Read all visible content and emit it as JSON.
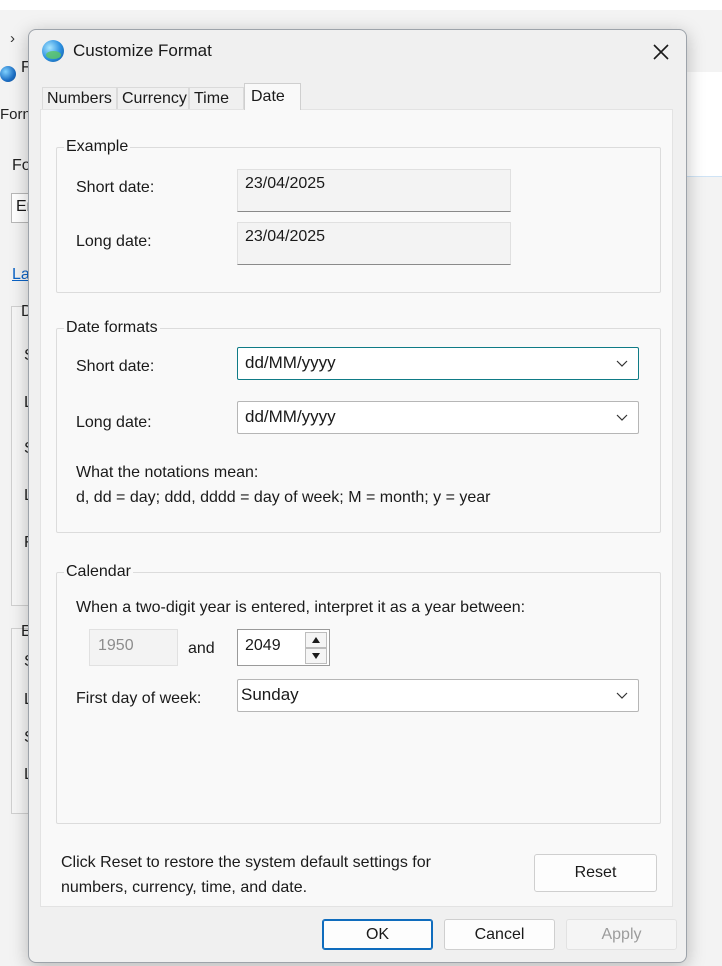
{
  "background": {
    "nav_glyph": "›",
    "labels": [
      "F",
      "Forn",
      "Fo",
      "Er",
      "La",
      "D",
      "S",
      "L",
      "S",
      "L",
      "F",
      "E",
      "S",
      "L",
      "S",
      "L"
    ]
  },
  "dialog": {
    "title": "Customize Format",
    "close_glyph": "✕",
    "tabs": [
      "Numbers",
      "Currency",
      "Time",
      "Date"
    ],
    "active_tab": "Date"
  },
  "example": {
    "legend": "Example",
    "short_label": "Short date:",
    "short_value": "23/04/2025",
    "long_label": "Long date:",
    "long_value": "23/04/2025"
  },
  "date_formats": {
    "legend": "Date formats",
    "short_label": "Short date:",
    "short_value": "dd/MM/yyyy",
    "long_label": "Long date:",
    "long_value": "dd/MM/yyyy",
    "notation_title": "What the notations mean:",
    "notation_text": "d, dd = day;  ddd, dddd = day of week;  M = month;  y = year"
  },
  "calendar": {
    "legend": "Calendar",
    "two_digit_text": "When a two-digit year is entered, interpret it as a year between:",
    "year_from": "1950",
    "and_label": "and",
    "year_to": "2049",
    "first_day_label": "First day of week:",
    "first_day_value": "Sunday"
  },
  "reset": {
    "text_line1": "Click Reset to restore the system default settings for",
    "text_line2": "numbers, currency, time, and date.",
    "button": "Reset"
  },
  "buttons": {
    "ok": "OK",
    "cancel": "Cancel",
    "apply": "Apply"
  },
  "icons": {
    "title": "globe-icon",
    "close": "close-icon",
    "dropdown": "chevron-down-icon",
    "spin_up": "arrow-up-icon",
    "spin_down": "arrow-down-icon"
  },
  "colors": {
    "focus": "#0f7b86",
    "default_button": "#0f6cbd",
    "link": "#0b63c5"
  }
}
